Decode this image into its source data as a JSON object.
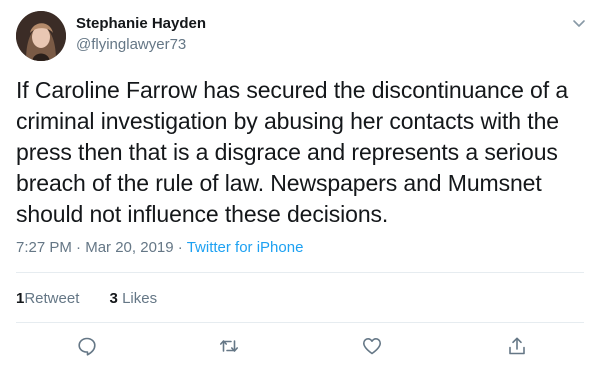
{
  "author": {
    "name": "Stephanie Hayden",
    "handle": "@flyinglawyer73"
  },
  "tweet": {
    "text": "If Caroline Farrow has secured the discontinuance of a criminal investigation by abusing her contacts with the press then that is a disgrace and represents a serious breach of the rule of law. Newspapers and Mumsnet should not influence these decisions.",
    "time": "7:27 PM",
    "separator": "·",
    "date": "Mar 20, 2019",
    "source": "Twitter for iPhone"
  },
  "stats": {
    "retweets_count": "1",
    "retweets_label": "Retweet",
    "likes_count": "3",
    "likes_label": "Likes"
  },
  "icons": {
    "menu": "chevron-down-icon",
    "reply": "reply-icon",
    "retweet": "retweet-icon",
    "like": "heart-icon",
    "share": "share-icon"
  },
  "colors": {
    "text": "#14171a",
    "secondary": "#657786",
    "link": "#1da1f2",
    "divider": "#e6ecf0"
  }
}
